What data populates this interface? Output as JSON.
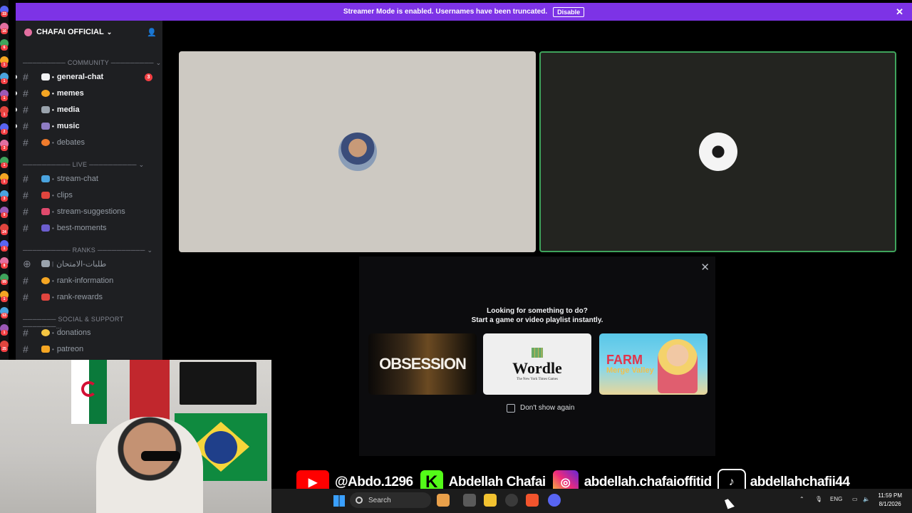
{
  "banner": {
    "message": "Streamer Mode is enabled. Usernames have been truncated.",
    "disable_label": "Disable",
    "close_icon": "close-icon"
  },
  "rail_pings": [
    "33",
    "16",
    "6",
    "1",
    "1",
    "1",
    "1",
    "2",
    "3",
    "1",
    "1",
    "3",
    "9",
    "24",
    "1",
    "8",
    "99",
    "1",
    "53",
    "1",
    "25"
  ],
  "server": {
    "name": "CHAFAI OFFICIAL",
    "invite_icon": "add-member-icon"
  },
  "categories": [
    {
      "label": "───────── COMMUNITY ───────── ⌄"
    },
    {
      "label": "────────── LIVE ────────── ⌄"
    },
    {
      "label": "────────── RANKS ────────── ⌄"
    },
    {
      "label": "─────── SOCIAL & SUPPORT ───────..."
    }
  ],
  "channels": [
    {
      "name": "general-chat",
      "emoji_color": "#f2f3f5",
      "unread": true,
      "badge": "3"
    },
    {
      "name": "memes",
      "emoji_color": "#f5a623",
      "unread": true,
      "badge": ""
    },
    {
      "name": "media",
      "emoji_color": "#9aa3ad",
      "unread": true,
      "badge": ""
    },
    {
      "name": "music",
      "emoji_color": "#8e7cc3",
      "unread": true,
      "badge": ""
    },
    {
      "name": "debates",
      "emoji_color": "#f07b2c",
      "unread": false,
      "badge": ""
    },
    {
      "name": "stream-chat",
      "emoji_color": "#4aa3df",
      "unread": false,
      "badge": ""
    },
    {
      "name": "clips",
      "emoji_color": "#e0453e",
      "unread": false,
      "badge": ""
    },
    {
      "name": "stream-suggestions",
      "emoji_color": "#e04a6d",
      "unread": false,
      "badge": ""
    },
    {
      "name": "best-moments",
      "emoji_color": "#6c5ecf",
      "unread": false,
      "badge": ""
    },
    {
      "name": "طلبات-الامتحان",
      "emoji_color": "#9aa3ad",
      "unread": false,
      "badge": ""
    },
    {
      "name": "rank-information",
      "emoji_color": "#f5a623",
      "unread": false,
      "badge": ""
    },
    {
      "name": "rank-rewards",
      "emoji_color": "#e0453e",
      "unread": false,
      "badge": ""
    },
    {
      "name": "donations",
      "emoji_color": "#f5c542",
      "unread": false,
      "badge": ""
    },
    {
      "name": "patreon",
      "emoji_color": "#f5a623",
      "unread": false,
      "badge": ""
    }
  ],
  "activity_popup": {
    "title": "Looking for something to do?",
    "subtitle": "Start a game or video playlist instantly.",
    "cards": [
      {
        "label": "OBSESSION"
      },
      {
        "label": "Wordle",
        "sub": "The New York Times Games"
      },
      {
        "label": "FARM",
        "sub": "Merge Valley"
      }
    ],
    "checkbox_label": "Don't show again",
    "checkbox_checked": false
  },
  "socials": [
    {
      "icon": "youtube-icon",
      "handle": "@Abdo.1296"
    },
    {
      "icon": "kick-icon",
      "glyph": "K",
      "handle": "Abdellah Chafai"
    },
    {
      "icon": "instagram-icon",
      "handle": "abdellah.chafaioffitid"
    },
    {
      "icon": "tiktok-icon",
      "handle": "abdellahchafii44"
    }
  ],
  "taskbar": {
    "search_placeholder": "Search",
    "language": "ENG",
    "time": "11:59 PM",
    "date": "8/1/2026"
  },
  "colors": {
    "banner": "#7d33e6",
    "speaking_outline": "#3fa45c",
    "mention_badge": "#f23f43"
  }
}
